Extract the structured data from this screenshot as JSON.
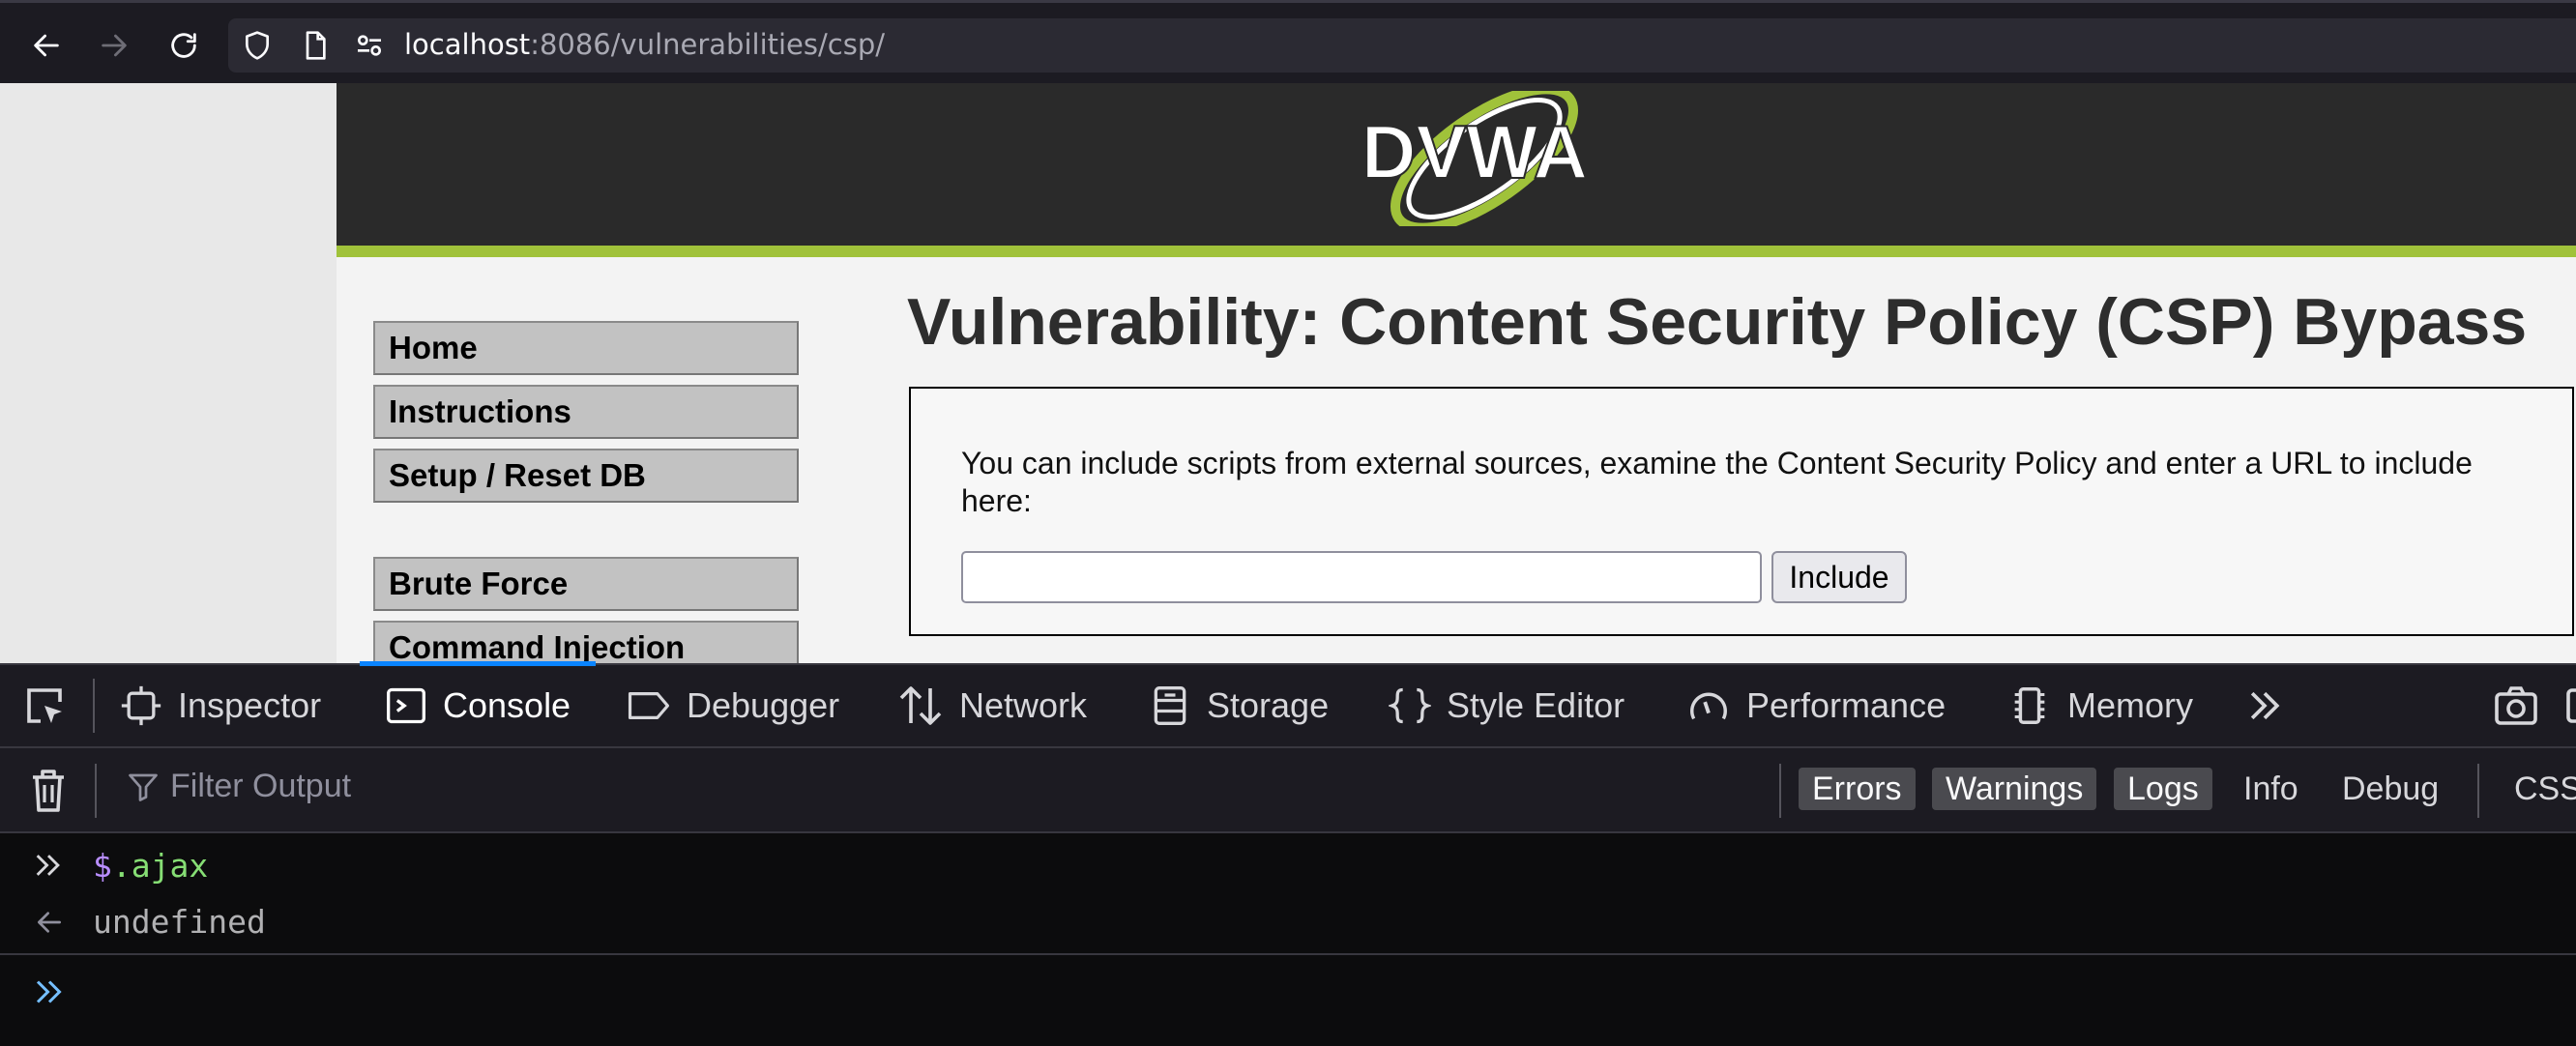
{
  "browser": {
    "url_host": "localhost",
    "url_rest": ":8086/vulnerabilities/csp/"
  },
  "dvwa": {
    "logo_text": "DVWA",
    "menu": [
      "Home",
      "Instructions",
      "Setup / Reset DB",
      "Brute Force",
      "Command Injection"
    ],
    "title": "Vulnerability: Content Security Policy (CSP) Bypass",
    "description": "You can include scripts from external sources, examine the Content Security Policy and enter a URL to include here:",
    "input_value": "",
    "include_label": "Include",
    "accent_color": "#a0c23a"
  },
  "devtools": {
    "tabs": [
      "Inspector",
      "Console",
      "Debugger",
      "Network",
      "Storage",
      "Style Editor",
      "Performance",
      "Memory"
    ],
    "active_tab": "Console",
    "filter_placeholder": "Filter Output",
    "filters": [
      "Errors",
      "Warnings",
      "Logs",
      "Info",
      "Debug",
      "CSS"
    ],
    "active_filters": [
      "Errors",
      "Warnings",
      "Logs"
    ],
    "console": {
      "input_dollar": "$",
      "input_rest": ".ajax",
      "result": "undefined"
    }
  }
}
